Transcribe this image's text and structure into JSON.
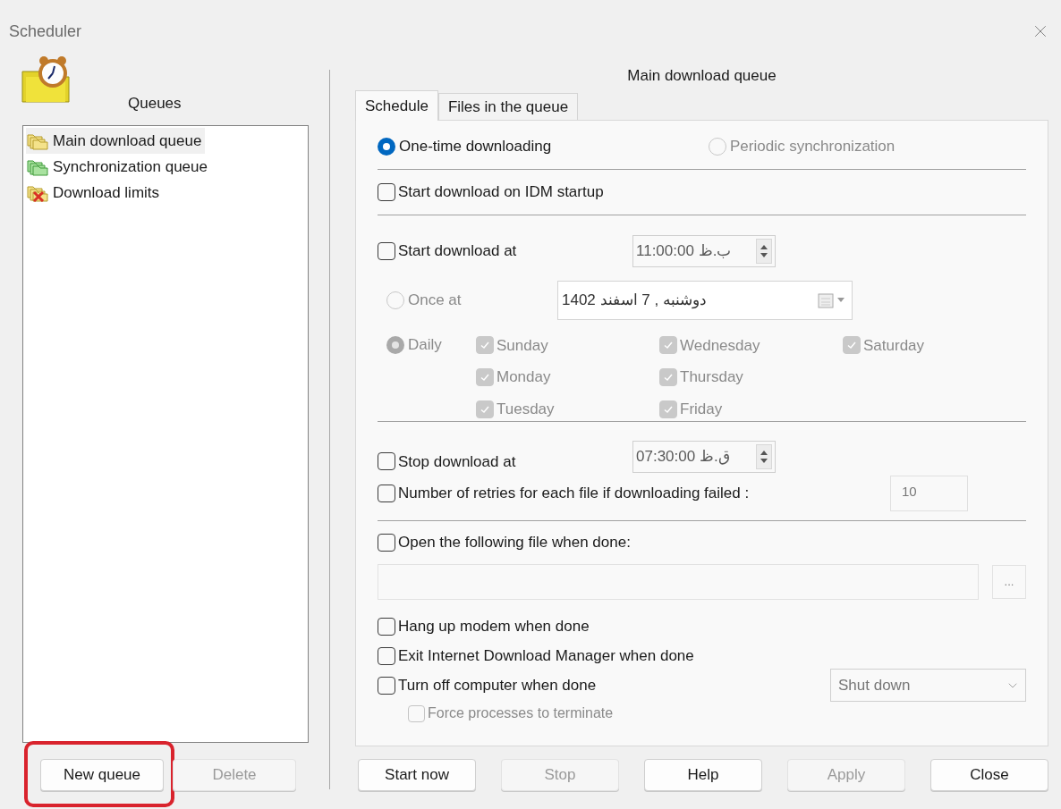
{
  "window": {
    "title": "Scheduler"
  },
  "queues_panel": {
    "title": "Queues",
    "items": [
      {
        "label": "Main download queue",
        "kind": "main",
        "selected": true
      },
      {
        "label": "Synchronization queue",
        "kind": "sync",
        "selected": false
      },
      {
        "label": "Download limits",
        "kind": "limits",
        "selected": false
      }
    ],
    "buttons": [
      {
        "label": "New queue",
        "disabled": false,
        "highlighted": true
      },
      {
        "label": "Delete",
        "disabled": true,
        "highlighted": false
      }
    ]
  },
  "queue_title": "Main download queue",
  "tabs": [
    {
      "label": "Schedule",
      "selected": true
    },
    {
      "label": "Files in the queue",
      "selected": false
    }
  ],
  "mode": [
    {
      "label": "One-time downloading",
      "selected": true,
      "disabled": false
    },
    {
      "label": "Periodic synchronization",
      "selected": false,
      "disabled": true
    }
  ],
  "start_on_startup": {
    "label": "Start download on IDM startup",
    "checked": false
  },
  "start_at": {
    "label": "Start download at",
    "checked": false,
    "time": "11:00:00 ب.ظ"
  },
  "once_at": {
    "label": "Once at",
    "selected": false,
    "disabled": true,
    "date": "دوشنبه , 7 اسفند 1402"
  },
  "daily": {
    "label": "Daily",
    "selected": true,
    "disabled": true,
    "days": [
      {
        "label": "Sunday",
        "checked": true,
        "disabled": true
      },
      {
        "label": "Monday",
        "checked": true,
        "disabled": true
      },
      {
        "label": "Tuesday",
        "checked": true,
        "disabled": true
      },
      {
        "label": "Wednesday",
        "checked": true,
        "disabled": true
      },
      {
        "label": "Thursday",
        "checked": true,
        "disabled": true
      },
      {
        "label": "Friday",
        "checked": true,
        "disabled": true
      },
      {
        "label": "Saturday",
        "checked": true,
        "disabled": true
      }
    ]
  },
  "stop_at": {
    "label": "Stop download at",
    "checked": false,
    "time": "07:30:00 ق.ظ"
  },
  "retries": {
    "label": "Number of retries for each file if downloading failed :",
    "checked": false,
    "value": "10"
  },
  "open_file": {
    "label": "Open the following file when done:",
    "checked": false,
    "browse": "..."
  },
  "when_done": [
    {
      "label": "Hang up modem when done",
      "checked": false
    },
    {
      "label": "Exit Internet Download Manager when done",
      "checked": false
    },
    {
      "label": "Turn off computer when done",
      "checked": false
    }
  ],
  "shutdown": {
    "value": "Shut down"
  },
  "force": {
    "label": "Force processes to terminate",
    "checked": false,
    "disabled": true
  },
  "actions": [
    {
      "label": "Start now",
      "disabled": false
    },
    {
      "label": "Stop",
      "disabled": true
    },
    {
      "label": "Help",
      "disabled": false
    },
    {
      "label": "Apply",
      "disabled": true
    },
    {
      "label": "Close",
      "disabled": false
    }
  ]
}
